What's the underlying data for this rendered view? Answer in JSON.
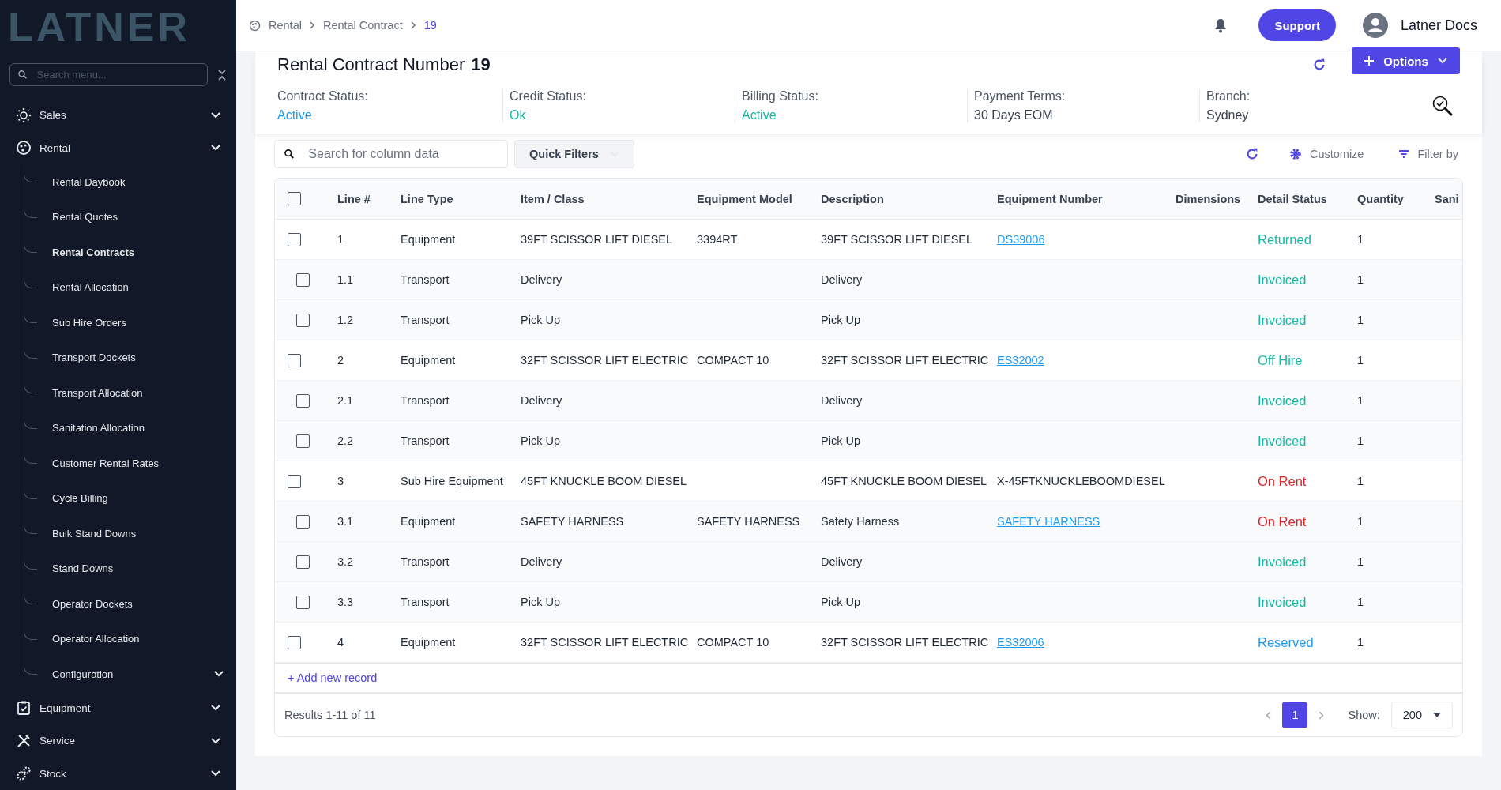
{
  "sidebar": {
    "logo": "LATNER",
    "search": {
      "placeholder": "Search menu..."
    },
    "items": [
      {
        "label": "Sales"
      },
      {
        "label": "Rental",
        "children": [
          {
            "label": "Rental Daybook",
            "selected": false,
            "expandable": false
          },
          {
            "label": "Rental Quotes",
            "selected": false,
            "expandable": false
          },
          {
            "label": "Rental Contracts",
            "selected": true,
            "expandable": false
          },
          {
            "label": "Rental Allocation",
            "selected": false,
            "expandable": false
          },
          {
            "label": "Sub Hire Orders",
            "selected": false,
            "expandable": false
          },
          {
            "label": "Transport Dockets",
            "selected": false,
            "expandable": false
          },
          {
            "label": "Transport Allocation",
            "selected": false,
            "expandable": false
          },
          {
            "label": "Sanitation Allocation",
            "selected": false,
            "expandable": false
          },
          {
            "label": "Customer Rental Rates",
            "selected": false,
            "expandable": false
          },
          {
            "label": "Cycle Billing",
            "selected": false,
            "expandable": false
          },
          {
            "label": "Bulk Stand Downs",
            "selected": false,
            "expandable": false
          },
          {
            "label": "Stand Downs",
            "selected": false,
            "expandable": false
          },
          {
            "label": "Operator Dockets",
            "selected": false,
            "expandable": false
          },
          {
            "label": "Operator Allocation",
            "selected": false,
            "expandable": false
          },
          {
            "label": "Configuration",
            "selected": false,
            "expandable": true
          }
        ]
      },
      {
        "label": "Equipment"
      },
      {
        "label": "Service"
      },
      {
        "label": "Stock"
      }
    ]
  },
  "header": {
    "breadcrumb": [
      {
        "label": "Rental",
        "selected": false
      },
      {
        "label": "Rental Contract",
        "selected": false
      },
      {
        "label": "19",
        "selected": true
      }
    ],
    "support_button": "Support",
    "user": "Latner Docs"
  },
  "contract": {
    "title": "Rental Contract Number",
    "number": "19",
    "options_button": "Options",
    "fields": [
      {
        "label": "Contract Status:",
        "value": "Active",
        "color": "#1e9bf0"
      },
      {
        "label": "Credit Status:",
        "value": "Ok",
        "color": "#14b8a6"
      },
      {
        "label": "Billing Status:",
        "value": "Active",
        "color": "#14b8a6"
      },
      {
        "label": "Payment Terms:",
        "value": "30 Days EOM",
        "color": "#374151"
      },
      {
        "label": "Branch:",
        "value": "Sydney",
        "color": "#374151"
      }
    ]
  },
  "toolbar": {
    "search": {
      "placeholder": "Search for column data"
    },
    "quick_filters": "Quick Filters",
    "customize": "Customize",
    "filter_by": "Filter by"
  },
  "table": {
    "header_checked": false,
    "columns": [
      "Line #",
      "Line Type",
      "Item / Class",
      "Equipment Model",
      "Description",
      "Equipment Number",
      "Dimensions",
      "Detail Status",
      "Quantity",
      "Sani"
    ],
    "rows": [
      {
        "line": "1",
        "line_type": "Equipment",
        "item_class": "39FT SCISSOR LIFT DIESEL",
        "model": "3394RT",
        "description": "39FT SCISSOR LIFT DIESEL",
        "equipment_number": "DS39006",
        "link": true,
        "status": "Returned",
        "color": "#14b8a6",
        "quantity": "1",
        "checked": false,
        "children": [
          {
            "line": "1.1",
            "line_type": "Transport",
            "item_class": "Delivery",
            "description": "Delivery",
            "status": "Invoiced",
            "color": "#14b8a6",
            "quantity": "1",
            "checked": false
          },
          {
            "line": "1.2",
            "line_type": "Transport",
            "item_class": "Pick Up",
            "description": "Pick Up",
            "status": "Invoiced",
            "color": "#14b8a6",
            "quantity": "1",
            "checked": false
          }
        ]
      },
      {
        "line": "2",
        "line_type": "Equipment",
        "item_class": "32FT SCISSOR LIFT ELECTRIC",
        "model": "COMPACT 10",
        "description": "32FT SCISSOR LIFT ELECTRIC",
        "equipment_number": "ES32002",
        "link": true,
        "status": "Off Hire",
        "color": "#14b8a6",
        "quantity": "1",
        "checked": false,
        "children": [
          {
            "line": "2.1",
            "line_type": "Transport",
            "item_class": "Delivery",
            "description": "Delivery",
            "status": "Invoiced",
            "color": "#14b8a6",
            "quantity": "1",
            "checked": false
          },
          {
            "line": "2.2",
            "line_type": "Transport",
            "item_class": "Pick Up",
            "description": "Pick Up",
            "status": "Invoiced",
            "color": "#14b8a6",
            "quantity": "1",
            "checked": false
          }
        ]
      },
      {
        "line": "3",
        "line_type": "Sub Hire Equipment",
        "item_class": "45FT KNUCKLE BOOM DIESEL",
        "description": "45FT KNUCKLE BOOM DIESEL",
        "equipment_number": "X-45FTKNUCKLEBOOMDIESEL",
        "link": false,
        "status": "On Rent",
        "color": "#dc2626",
        "quantity": "1",
        "checked": false,
        "children": [
          {
            "line": "3.1",
            "line_type": "Equipment",
            "item_class": "SAFETY HARNESS",
            "model": "SAFETY HARNESS",
            "description": "Safety Harness",
            "equipment_number": "SAFETY HARNESS",
            "link": true,
            "status": "On Rent",
            "color": "#dc2626",
            "quantity": "1",
            "checked": false
          },
          {
            "line": "3.2",
            "line_type": "Transport",
            "item_class": "Delivery",
            "description": "Delivery",
            "status": "Invoiced",
            "color": "#14b8a6",
            "quantity": "1",
            "checked": false
          },
          {
            "line": "3.3",
            "line_type": "Transport",
            "item_class": "Pick Up",
            "description": "Pick Up",
            "status": "Invoiced",
            "color": "#14b8a6",
            "quantity": "1",
            "checked": false
          }
        ]
      },
      {
        "line": "4",
        "line_type": "Equipment",
        "item_class": "32FT SCISSOR LIFT ELECTRIC",
        "model": "COMPACT 10",
        "description": "32FT SCISSOR LIFT ELECTRIC",
        "equipment_number": "ES32006",
        "link": true,
        "status": "Reserved",
        "color": "#1e9bf0",
        "quantity": "1",
        "checked": false
      }
    ]
  },
  "footer": {
    "add_record": "+ Add new record",
    "results": "Results 1-11 of 11",
    "pages": [
      {
        "label": "1",
        "selected": true
      }
    ],
    "show_label": "Show:",
    "page_size": "200"
  }
}
